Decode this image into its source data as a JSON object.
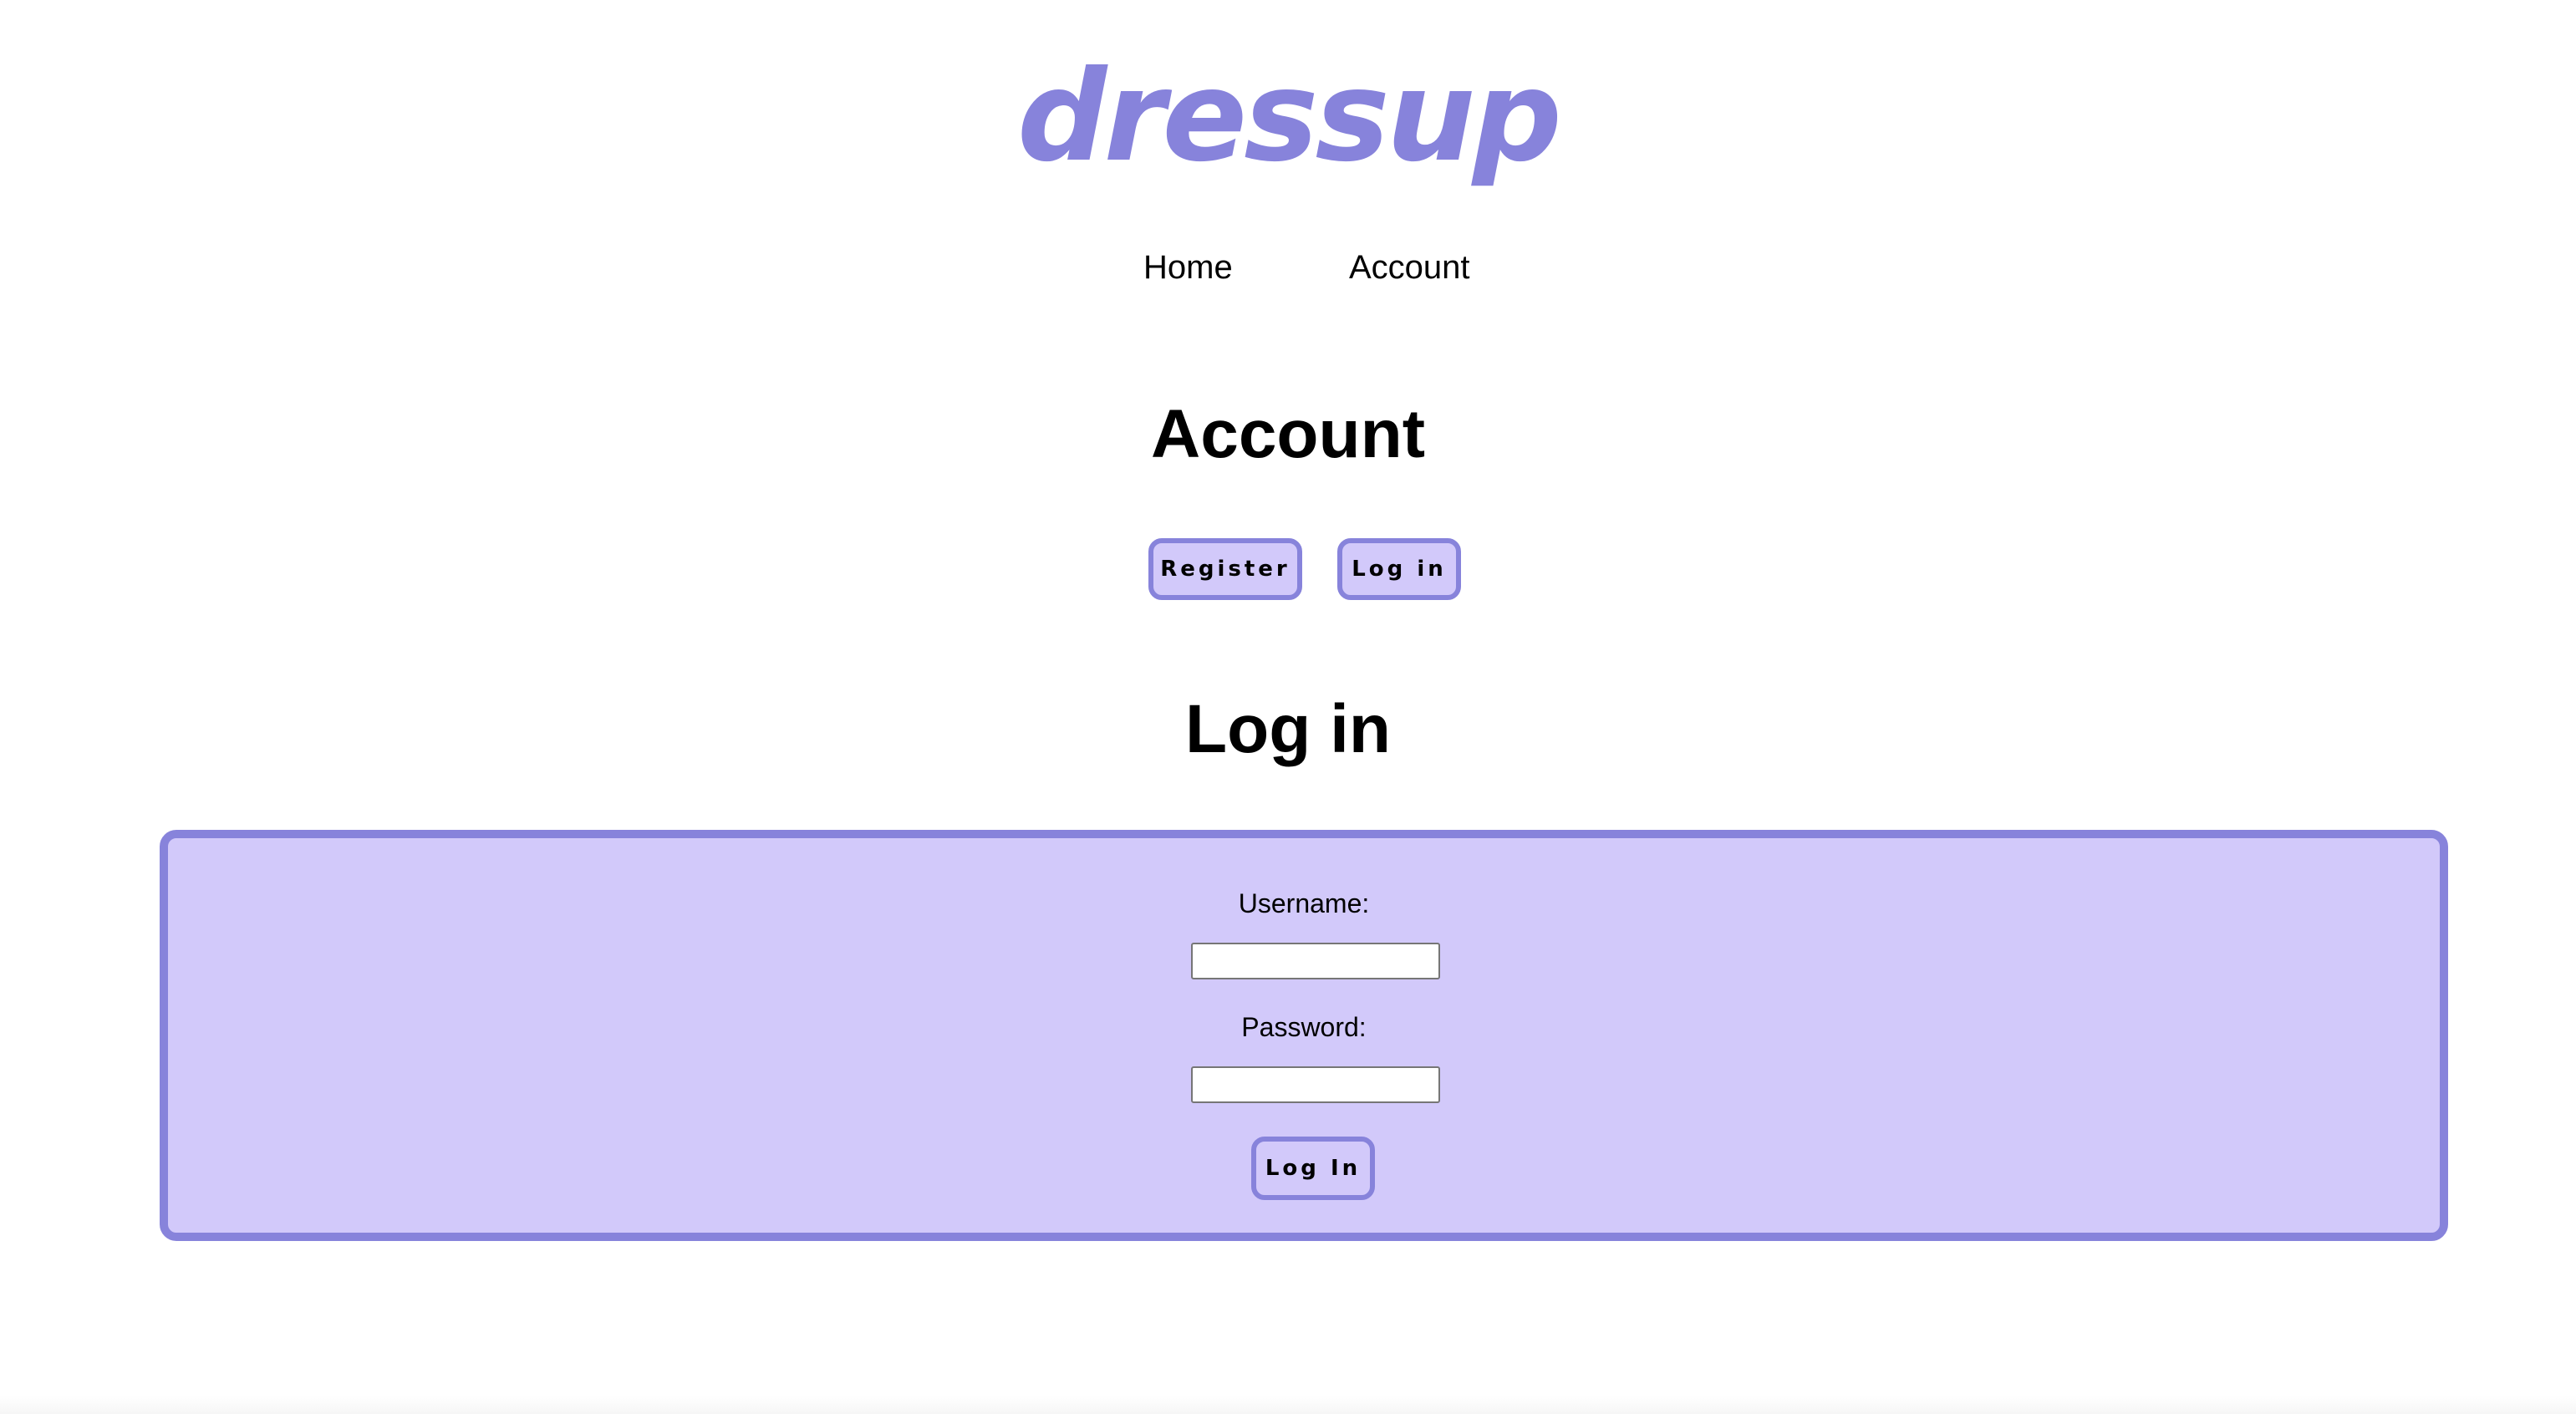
{
  "brand": {
    "logo_text": "dressup",
    "accent_color": "#8783db",
    "panel_color": "#d2c9fa"
  },
  "nav": {
    "items": [
      {
        "label": "Home"
      },
      {
        "label": "Account"
      }
    ]
  },
  "account_section": {
    "title": "Account",
    "buttons": {
      "register_label": "Register",
      "login_label": "Log in"
    }
  },
  "login_section": {
    "title": "Log in",
    "form": {
      "username_label": "Username:",
      "username_value": "",
      "password_label": "Password:",
      "password_value": "",
      "submit_label": "Log In"
    }
  }
}
